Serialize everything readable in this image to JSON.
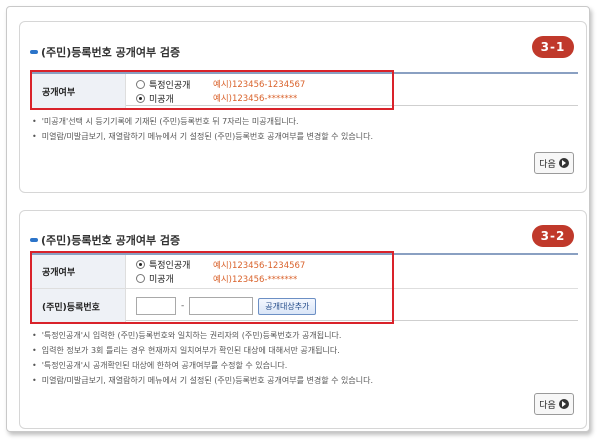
{
  "panel1": {
    "title": "(주민)등록번호 공개여부 검증",
    "badge": "3-1",
    "field_label": "공개여부",
    "options": [
      {
        "label": "특정인공개",
        "example": "예시)123456-1234567",
        "selected": false
      },
      {
        "label": "미공개",
        "example": "예시)123456-*******",
        "selected": true
      }
    ],
    "notes": [
      "'미공개'선택 시 등기기록에 기재된 (주민)등록번호 뒤 7자리는 미공개됩니다.",
      "미열람/미발급보기, 재열람하기 메뉴에서 기 설정된 (주민)등록번호 공개여부를 변경할 수 있습니다."
    ],
    "next_label": "다음"
  },
  "panel2": {
    "title": "(주민)등록번호 공개여부 검증",
    "badge": "3-2",
    "field_label": "공개여부",
    "options": [
      {
        "label": "특정인공개",
        "example": "예시)123456-1234567",
        "selected": true
      },
      {
        "label": "미공개",
        "example": "예시)123456-*******",
        "selected": false
      }
    ],
    "id_label": "(주민)등록번호",
    "id_first_value": "",
    "id_second_value": "",
    "dash": "-",
    "lookup_button": "공개대상추가",
    "notes": [
      "'특정인공개'시 입력한 (주민)등록번호와 일치하는 권리자의 (주민)등록번호가 공개됩니다.",
      "입력한 정보가 3회 틀리는 경우 현재까지 일치여부가 확인된 대상에 대해서만 공개됩니다.",
      "'특정인공개'시 공개확인된 대상에 한하여 공개여부를 수정할 수 있습니다.",
      "미열람/미발급보기, 재열람하기 메뉴에서 기 설정된 (주민)등록번호 공개여부를 변경할 수 있습니다."
    ],
    "next_label": "다음"
  },
  "colors": {
    "accent_blue": "#2c74c9",
    "badge_red": "#c0392b",
    "highlight_red": "#d9222a",
    "example_orange": "#d9622b"
  }
}
